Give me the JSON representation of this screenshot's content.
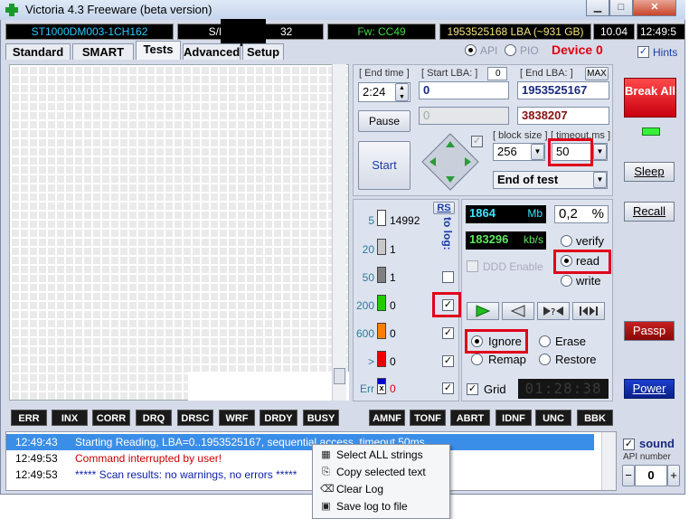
{
  "window": {
    "title": "Victoria 4.3 Freeware (beta version)",
    "min": "▁",
    "max": "□",
    "close": "✕"
  },
  "infobar": {
    "model": "ST1000DM003-1CH162",
    "serial_prefix": "S/N:",
    "serial_visible": "2",
    "serial_suffix": "32",
    "firmware": "Fw: CC49",
    "lba": "1953525168 LBA (~931 GB)",
    "version": "10.04",
    "time": "12:49:5"
  },
  "mode": {
    "api_label": "API",
    "pio_label": "PIO",
    "device": "Device 0",
    "hints": "Hints"
  },
  "tabs": [
    {
      "label": "Standard"
    },
    {
      "label": "SMART"
    },
    {
      "label": "Tests"
    },
    {
      "label": "Advanced"
    },
    {
      "label": "Setup"
    }
  ],
  "test": {
    "end_time_label": "[ End time ]",
    "end_time_value": "2:24",
    "start_lba_label": "[ Start LBA: ]",
    "start_lba_small": "0",
    "start_lba_value": "0",
    "end_lba_label": "[ End LBA: ]",
    "end_lba_max": "MAX",
    "end_lba_value": "1953525167",
    "pause": "Pause",
    "current_lba": "0",
    "remaining": "3838207",
    "start": "Start",
    "block_size_label": "[ block size ]",
    "block_size_value": "256",
    "timeout_label": "[ timeout,ms ]",
    "timeout_value": "50",
    "end_action": "End of test"
  },
  "legend": {
    "rs": "RS",
    "to_log": "to log:",
    "items": [
      {
        "ms": "5",
        "count": "14992",
        "color": "#ffffff"
      },
      {
        "ms": "20",
        "count": "1",
        "color": "#c8c8c8"
      },
      {
        "ms": "50",
        "count": "1",
        "color": "#808080"
      },
      {
        "ms": "200",
        "count": "0",
        "color": "#22cc00"
      },
      {
        "ms": "600",
        "count": "0",
        "color": "#ff7f00"
      },
      {
        "ms": ">",
        "count": "0",
        "color": "#ee0000"
      },
      {
        "ms": "Err",
        "count": "0",
        "color": "#0000cc"
      }
    ]
  },
  "stats": {
    "mb": "1864",
    "mb_unit": "Mb",
    "percent": "0,2",
    "percent_unit": "%",
    "speed": "183296",
    "speed_unit": "kb/s",
    "ddd": "DDD Enable"
  },
  "rw": {
    "verify": "verify",
    "read": "read",
    "write": "write"
  },
  "action": {
    "ignore": "Ignore",
    "erase": "Erase",
    "remap": "Remap",
    "restore": "Restore",
    "grid": "Grid",
    "timer": "01:28:38"
  },
  "right": {
    "break": "Break All",
    "sleep": "Sleep",
    "recall": "Recall",
    "passp": "Passp",
    "power": "Power",
    "sound": "sound",
    "api_number_label": "API number",
    "api_number": "0"
  },
  "status": [
    "ERR",
    "INX",
    "CORR",
    "DRQ",
    "DRSC",
    "WRF",
    "DRDY",
    "BUSY",
    "AMNF",
    "TONF",
    "ABRT",
    "IDNF",
    "UNC",
    "BBK"
  ],
  "log": [
    {
      "time": "12:49:43",
      "text": "Starting Reading, LBA=0..1953525167, sequential access, timeout 50ms",
      "color": "#ffffff"
    },
    {
      "time": "12:49:53",
      "text": "Command interrupted by user!",
      "color": "#cc0000"
    },
    {
      "time": "12:49:53",
      "text": "***** Scan results: no warnings, no errors *****",
      "color": "#0a1ea8"
    }
  ],
  "context_menu": [
    {
      "label": "Select ALL strings",
      "icon": "select-all-icon",
      "glyph": "▦"
    },
    {
      "label": "Copy selected text",
      "icon": "copy-icon",
      "glyph": "⎘"
    },
    {
      "label": "Clear Log",
      "icon": "eraser-icon",
      "glyph": "⌫"
    },
    {
      "label": "Save log to file",
      "icon": "floppy-icon",
      "glyph": "▣"
    }
  ]
}
